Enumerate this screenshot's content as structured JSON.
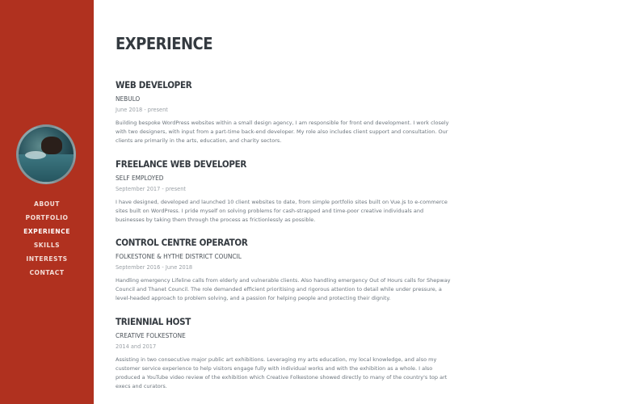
{
  "sidebar": {
    "nav": [
      {
        "label": "ABOUT",
        "active": false
      },
      {
        "label": "PORTFOLIO",
        "active": false
      },
      {
        "label": "EXPERIENCE",
        "active": true
      },
      {
        "label": "SKILLS",
        "active": false
      },
      {
        "label": "INTERESTS",
        "active": false
      },
      {
        "label": "CONTACT",
        "active": false
      }
    ],
    "accent_color": "#b0311f"
  },
  "main": {
    "title": "EXPERIENCE",
    "entries": [
      {
        "role": "WEB DEVELOPER",
        "org": "NEBULO",
        "dates": "June 2018 - present",
        "description": "Building bespoke WordPress websites within a small design agency, I am responsible for front end development. I work closely with two designers, with input from a part-time back-end developer. My role also includes client support and consultation. Our clients are primarily in the arts, education, and charity sectors."
      },
      {
        "role": "FREELANCE WEB DEVELOPER",
        "org": "SELF EMPLOYED",
        "dates": "September 2017 - present",
        "description": "I have designed, developed and launched 10 client websites to date, from simple portfolio sites built on Vue.js to e-commerce sites built on WordPress. I pride myself on solving problems for cash-strapped and time-poor creative individuals and businesses by taking them through the process as frictionlessly as possible."
      },
      {
        "role": "CONTROL CENTRE OPERATOR",
        "org": "FOLKESTONE & HYTHE DISTRICT COUNCIL",
        "dates": "September 2016 - June 2018",
        "description": "Handling emergency Lifeline calls from elderly and vulnerable clients. Also handling emergency Out of Hours calls for Shepway Council and Thanet Council. The role demanded efficient prioritising and rigorous attention to detail while under pressure, a level-headed approach to problem solving, and a passion for helping people and protecting their dignity."
      },
      {
        "role": "TRIENNIAL HOST",
        "org": "CREATIVE FOLKESTONE",
        "dates": "2014 and 2017",
        "description": "Assisting in two consecutive major public art exhibitions. Leveraging my arts education, my local knowledge, and also my customer service experience to help visitors engage fully with individual works and with the exhibition as a whole. I also produced a YouTube video review of the exhibition which Creative Folkestone showed directly to many of the country's top art execs and curators."
      }
    ]
  }
}
